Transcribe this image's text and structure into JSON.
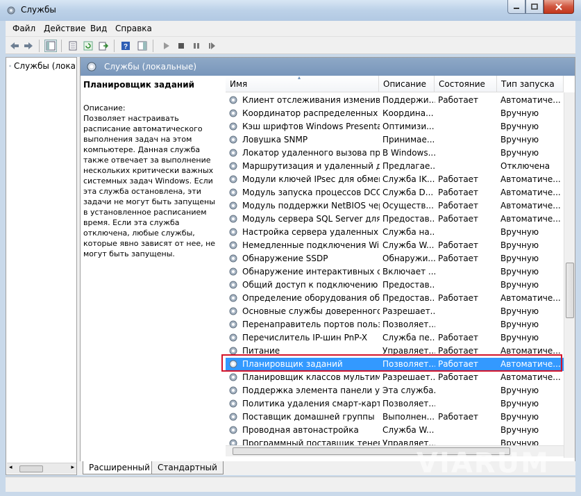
{
  "window": {
    "title": "Службы"
  },
  "menu": [
    "Файл",
    "Действие",
    "Вид",
    "Справка"
  ],
  "tree": {
    "item": "Службы (лока"
  },
  "pane": {
    "header": "Службы (локальные)"
  },
  "description": {
    "service_name": "Планировщик заданий",
    "label": "Описание:",
    "text": "Позволяет настраивать расписание автоматического выполнения задач на этом компьютере. Данная служба также отвечает за выполнение нескольких критически важных системных задач Windows. Если эта служба остановлена, эти задачи не могут быть запущены в установленное расписанием время. Если эта служба отключена, любые службы, которые явно зависят от нее, не могут быть запущены."
  },
  "columns": [
    "Имя",
    "Описание",
    "Состояние",
    "Тип запуска"
  ],
  "rows": [
    [
      "Клиент отслеживания изменивш...",
      "Поддержи...",
      "Работает",
      "Автоматиче..."
    ],
    [
      "Координатор распределенных тр...",
      "Координа...",
      "",
      "Вручную"
    ],
    [
      "Кэш шрифтов Windows Presentati...",
      "Оптимизи...",
      "",
      "Вручную"
    ],
    [
      "Ловушка SNMP",
      "Принимае...",
      "",
      "Вручную"
    ],
    [
      "Локатор удаленного вызова проц...",
      "В Windows...",
      "",
      "Вручную"
    ],
    [
      "Маршрутизация и удаленный дос...",
      "Предлагае...",
      "",
      "Отключена"
    ],
    [
      "Модули ключей IPsec для обмена...",
      "Служба IK...",
      "Работает",
      "Автоматиче..."
    ],
    [
      "Модуль запуска процессов DCO...",
      "Служба D...",
      "Работает",
      "Автоматиче..."
    ],
    [
      "Модуль поддержки NetBIOS чере...",
      "Осуществ...",
      "Работает",
      "Автоматиче..."
    ],
    [
      "Модуль сервера SQL Server для за...",
      "Предостав...",
      "Работает",
      "Автоматиче..."
    ],
    [
      "Настройка сервера удаленных ра...",
      "Служба на...",
      "",
      "Вручную"
    ],
    [
      "Немедленные подключения Win...",
      "Служба W...",
      "Работает",
      "Вручную"
    ],
    [
      "Обнаружение SSDP",
      "Обнаружи...",
      "Работает",
      "Вручную"
    ],
    [
      "Обнаружение интерактивных слу...",
      "Включает ...",
      "",
      "Вручную"
    ],
    [
      "Общий доступ к подключению к ...",
      "Предостав...",
      "",
      "Вручную"
    ],
    [
      "Определение оборудования обол...",
      "Предостав...",
      "Работает",
      "Автоматиче..."
    ],
    [
      "Основные службы доверенного ...",
      "Разрешает...",
      "",
      "Вручную"
    ],
    [
      "Перенаправитель портов пользо...",
      "Позволяет...",
      "",
      "Вручную"
    ],
    [
      "Перечислитель IP-шин PnP-X",
      "Служба пе...",
      "Работает",
      "Вручную"
    ],
    [
      "Питание",
      "Управляет...",
      "Работает",
      "Автоматиче..."
    ],
    [
      "Планировщик заданий",
      "Позволяет...",
      "Работает",
      "Автоматиче..."
    ],
    [
      "Планировщик классов мультиме...",
      "Разрешает...",
      "Работает",
      "Автоматиче..."
    ],
    [
      "Поддержка элемента панели упр...",
      "Эта служба...",
      "",
      "Вручную"
    ],
    [
      "Политика удаления смарт-карт",
      "Позволяет...",
      "",
      "Вручную"
    ],
    [
      "Поставщик домашней группы",
      "Выполнен...",
      "Работает",
      "Вручную"
    ],
    [
      "Проводная автонастройка",
      "Служба W...",
      "",
      "Вручную"
    ],
    [
      "Программный поставщик тенево...",
      "Управляет...",
      "",
      "Вручную"
    ]
  ],
  "selected_index": 20,
  "tabs": [
    "Расширенный",
    "Стандартный"
  ],
  "watermark": "VIARUM",
  "colors": {
    "selection": "#3399ff",
    "highlight_border": "#d4142a",
    "header": "#7896bb"
  }
}
